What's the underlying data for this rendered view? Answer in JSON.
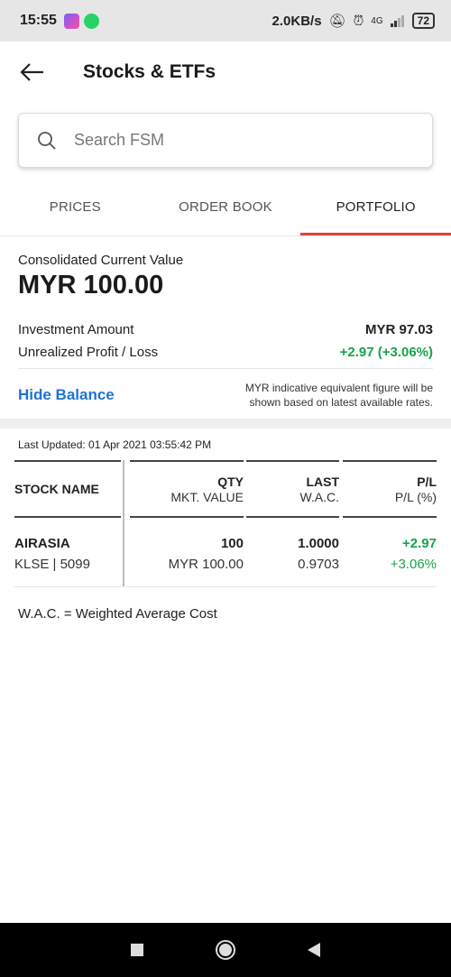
{
  "status_bar": {
    "time": "15:55",
    "net_speed": "2.0KB/s",
    "network": "4G",
    "battery": "72"
  },
  "header": {
    "title": "Stocks & ETFs"
  },
  "search": {
    "placeholder": "Search FSM"
  },
  "tabs": [
    {
      "label": "PRICES",
      "active": false
    },
    {
      "label": "ORDER BOOK",
      "active": false
    },
    {
      "label": "PORTFOLIO",
      "active": true
    }
  ],
  "summary": {
    "consolidated_label": "Consolidated Current Value",
    "consolidated_value": "MYR 100.00",
    "investment_label": "Investment Amount",
    "investment_value": "MYR 97.03",
    "upl_label": "Unrealized Profit / Loss",
    "upl_value": "+2.97 (+3.06%)",
    "hide_balance": "Hide Balance",
    "note": "MYR indicative equivalent figure will be shown based on latest available rates."
  },
  "last_updated": "Last Updated: 01 Apr 2021 03:55:42 PM",
  "table": {
    "headers": {
      "stock_name": "STOCK NAME",
      "qty": "QTY",
      "mkt_value": "MKT. VALUE",
      "last": "LAST",
      "wac": "W.A.C.",
      "pl": "P/L",
      "pl_pct": "P/L (%)"
    },
    "rows": [
      {
        "name": "AIRASIA",
        "code": "KLSE | 5099",
        "qty": "100",
        "mkt_value": "MYR 100.00",
        "last": "1.0000",
        "wac": "0.9703",
        "pl": "+2.97",
        "pl_pct": "+3.06%"
      }
    ]
  },
  "footnote": "W.A.C. = Weighted Average Cost",
  "colors": {
    "accent_tab": "#d9453b",
    "link_blue": "#1f72d6",
    "positive_green": "#17a34a"
  },
  "icons": {
    "back": "arrow-left-icon",
    "search": "search-icon",
    "nav_recent": "square-icon",
    "nav_home": "circle-icon",
    "nav_back": "triangle-back-icon"
  }
}
